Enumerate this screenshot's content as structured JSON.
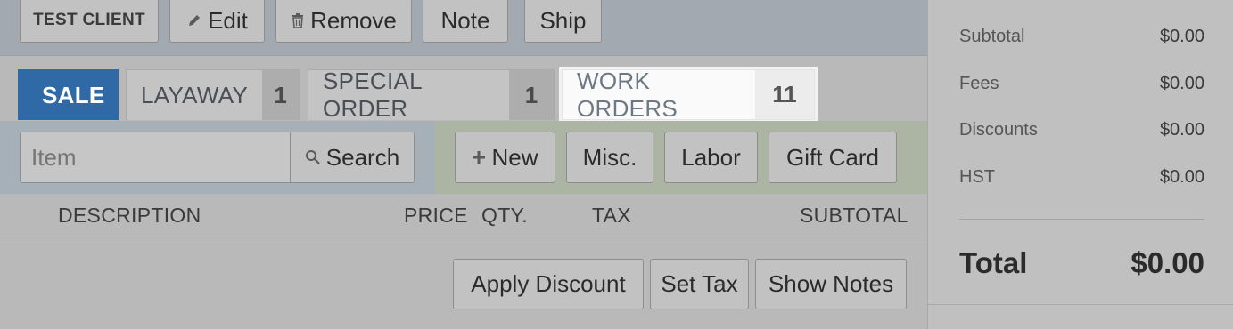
{
  "toolbar": {
    "client_label": "TEST CLIENT",
    "edit_label": "Edit",
    "remove_label": "Remove",
    "note_label": "Note",
    "ship_label": "Ship"
  },
  "tabs": [
    {
      "label": "SALE",
      "count": ""
    },
    {
      "label": "LAYAWAY",
      "count": "1"
    },
    {
      "label": "SPECIAL ORDER",
      "count": "1"
    },
    {
      "label": "WORK ORDERS",
      "count": "11"
    }
  ],
  "search": {
    "placeholder": "Item",
    "button_label": "Search"
  },
  "add_items": {
    "new_label": "New",
    "misc_label": "Misc.",
    "labor_label": "Labor",
    "gift_card_label": "Gift Card"
  },
  "columns": {
    "description": "DESCRIPTION",
    "price": "PRICE",
    "qty": "QTY.",
    "tax": "TAX",
    "subtotal": "SUBTOTAL"
  },
  "actions": {
    "apply_discount": "Apply Discount",
    "set_tax": "Set Tax",
    "show_notes": "Show Notes"
  },
  "summary": {
    "subtotal_label": "Subtotal",
    "subtotal_value": "$0.00",
    "fees_label": "Fees",
    "fees_value": "$0.00",
    "discounts_label": "Discounts",
    "discounts_value": "$0.00",
    "hst_label": "HST",
    "hst_value": "$0.00",
    "total_label": "Total",
    "total_value": "$0.00"
  },
  "colors": {
    "active_tab": "#2f6aa6",
    "search_panel": "#a6b0b9",
    "add_panel": "#acb5a3",
    "highlight_tab": "#fafafa"
  }
}
